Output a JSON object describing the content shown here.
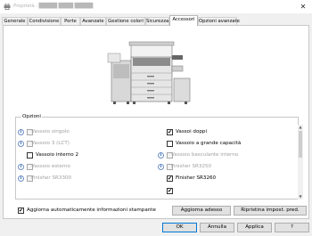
{
  "window": {
    "title_blurred": "Proprietà - █████ ████ █████",
    "close_glyph": "✕"
  },
  "tabs": [
    {
      "label": "Generale"
    },
    {
      "label": "Condivisione"
    },
    {
      "label": "Porte"
    },
    {
      "label": "Avanzate"
    },
    {
      "label": "Gestione colori"
    },
    {
      "label": "Sicurezza"
    },
    {
      "label": "Accessori",
      "active": true
    },
    {
      "label": "Opzioni avanzate"
    }
  ],
  "options": {
    "group_label": "Opzioni",
    "info_glyph": "i",
    "check_glyph": "✔",
    "items": [
      {
        "label": "Vassoio singolo",
        "checked": false,
        "enabled": false
      },
      {
        "label": "Vassoi doppi",
        "checked": true,
        "enabled": true
      },
      {
        "label": "Vassoio 3 (LCT)",
        "checked": false,
        "enabled": false
      },
      {
        "label": "Vassoio a grande capacità",
        "checked": false,
        "enabled": true
      },
      {
        "label": "Vassoio interno 2",
        "checked": false,
        "enabled": true
      },
      {
        "label": "Vassoio basculante interno",
        "checked": false,
        "enabled": false
      },
      {
        "label": "Vassoio esterno",
        "checked": false,
        "enabled": false
      },
      {
        "label": "Finisher SR3250",
        "checked": false,
        "enabled": false
      },
      {
        "label": "Finisher SR3300",
        "checked": false,
        "enabled": false
      },
      {
        "label": "Finisher SR3260",
        "checked": true,
        "enabled": true
      }
    ]
  },
  "auto_update": {
    "label": "Aggiorna automaticamente informazioni stampante",
    "checked": true
  },
  "buttons": {
    "update_now": "Aggiorna adesso",
    "restore_defaults": "Ripristina impost. pred."
  },
  "footer": {
    "ok": "OK",
    "cancel": "Annulla",
    "apply": "Applica",
    "help": "?"
  },
  "colors": {
    "accent": "#0078d7",
    "info": "#3b6bb5"
  }
}
